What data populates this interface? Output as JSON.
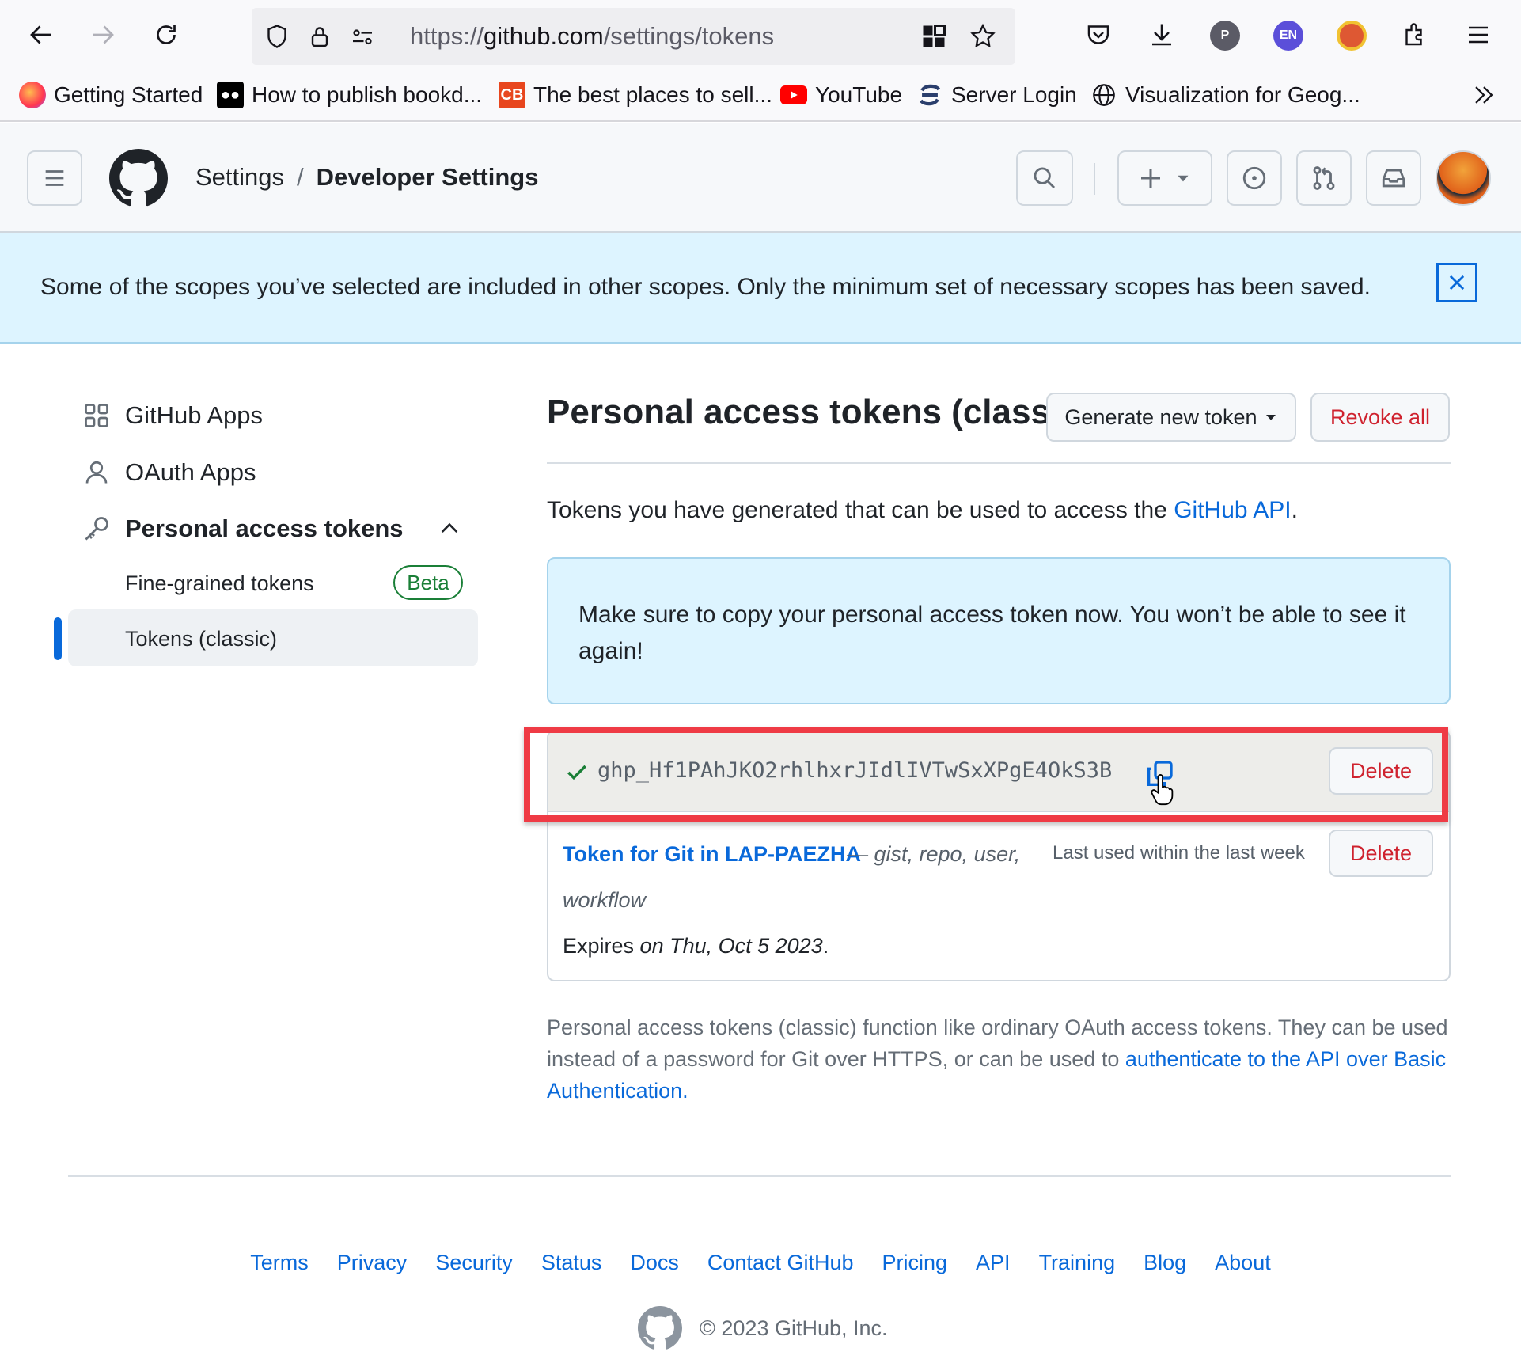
{
  "browser": {
    "url_prefix": "https://",
    "url_host": "github.com",
    "url_path": "/settings/tokens",
    "extensions": [
      {
        "name": "profile-extension",
        "label": "P",
        "color": "#5b5b66"
      },
      {
        "name": "language-extension",
        "label": "EN",
        "color": "#5b4fd9"
      },
      {
        "name": "duckduckgo-extension",
        "label": "",
        "color": "#de5833"
      }
    ]
  },
  "bookmarks": [
    {
      "label": "Getting Started",
      "icon": "firefox-icon"
    },
    {
      "label": "How to publish bookd...",
      "icon": "medium-icon"
    },
    {
      "label": "The best places to sell...",
      "icon": "cb-icon"
    },
    {
      "label": "YouTube",
      "icon": "youtube-icon"
    },
    {
      "label": "Server Login",
      "icon": "server-icon"
    },
    {
      "label": "Visualization for Geog...",
      "icon": "globe-icon"
    }
  ],
  "header": {
    "crumb_settings": "Settings",
    "crumb_separator": "/",
    "crumb_current": "Developer Settings"
  },
  "flash": {
    "message": "Some of the scopes you’ve selected are included in other scopes. Only the minimum set of necessary scopes has been saved.",
    "close_glyph": "✕"
  },
  "sidebar": {
    "github_apps": "GitHub Apps",
    "oauth_apps": "OAuth Apps",
    "personal_access_tokens": "Personal access tokens",
    "fine_grained": "Fine-grained tokens",
    "beta": "Beta",
    "tokens_classic": "Tokens (classic)"
  },
  "main": {
    "title": "Personal access tokens (classic)",
    "generate_button": "Generate new token",
    "revoke_button": "Revoke all",
    "intro_prefix": "Tokens you have generated that can be used to access the ",
    "intro_link": "GitHub API",
    "intro_suffix": ".",
    "warning": "Make sure to copy your personal access token now. You won’t be able to see it again!",
    "new_token": "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",
    "delete_label": "Delete",
    "token_name": "Token for Git in LAP-PAEZHA",
    "token_scopes_a": "— gist, repo, user,",
    "token_scopes_b": "workflow",
    "token_last_used": "Last used within the last week",
    "expires_prefix": "Expires",
    "expires_date": "on Thu, Oct 5 2023",
    "expires_suffix": ".",
    "footnote_text": "Personal access tokens (classic) function like ordinary OAuth access tokens. They can be used instead of a password for Git over HTTPS, or can be used to ",
    "footnote_link": "authenticate to the API over Basic Authentication",
    "footnote_suffix": "."
  },
  "footer": {
    "links": [
      "Terms",
      "Privacy",
      "Security",
      "Status",
      "Docs",
      "Contact GitHub",
      "Pricing",
      "API",
      "Training",
      "Blog",
      "About"
    ],
    "copyright": "© 2023 GitHub, Inc."
  },
  "colors": {
    "accent": "#0969da",
    "danger": "#cf222e",
    "success": "#1a7f37",
    "highlight": "#ef3b45",
    "flash_bg": "#ddf4ff"
  }
}
